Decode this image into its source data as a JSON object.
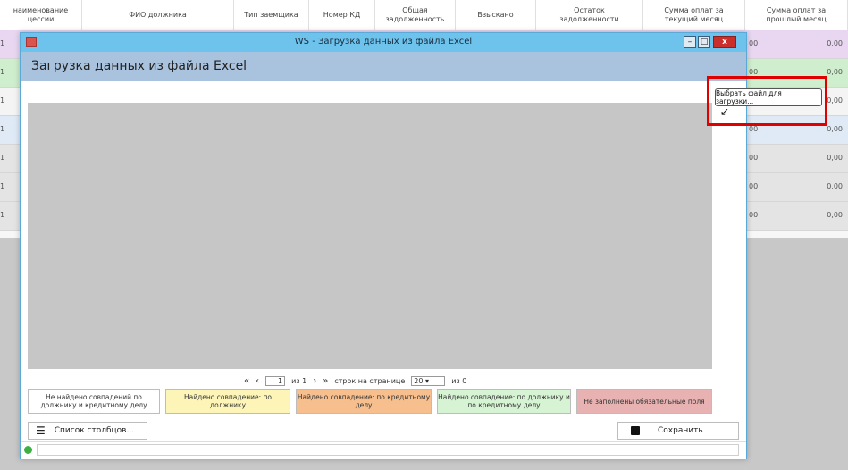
{
  "background": {
    "columns": [
      {
        "label": "наименование\nцессии"
      },
      {
        "label": "ФИО должника"
      },
      {
        "label": "Тип заемщика"
      },
      {
        "label": "Номер КД"
      },
      {
        "label": "Общая\nзадолженность"
      },
      {
        "label": "Взыскано"
      },
      {
        "label": "Остаток\nзадолженности"
      },
      {
        "label": "Сумма оплат за\nтекущий месяц"
      },
      {
        "label": "Сумма оплат за\nпрошлый месяц"
      }
    ],
    "rows": [
      {
        "left": "1",
        "mid": "00",
        "value": "0,00",
        "color": "#e9d7f2"
      },
      {
        "left": "1",
        "mid": "00",
        "value": "0,00",
        "color": "#cfeecd"
      },
      {
        "left": "1",
        "mid": "00",
        "value": "0,00",
        "color": "#f4f4f4"
      },
      {
        "left": "1",
        "mid": "00",
        "value": "0,00",
        "color": "#dfeaf6"
      },
      {
        "left": "1",
        "mid": "00",
        "value": "0,00",
        "color": "#e4e4e4"
      },
      {
        "left": "1",
        "mid": "00",
        "value": "0,00",
        "color": "#e4e4e4"
      },
      {
        "left": "1",
        "mid": "00",
        "value": "0,00",
        "color": "#e4e4e4"
      }
    ]
  },
  "dialog": {
    "window_title": "WS - Загрузка данных из файла Excel",
    "heading": "Загрузка данных из файла Excel",
    "min_label": "–",
    "max_label": "□",
    "close_label": "x",
    "pager": {
      "first": "«",
      "prev": "‹",
      "page": "1",
      "of": "из 1",
      "next": "›",
      "last": "»",
      "rows_label": "строк на странице",
      "rows_value": "20",
      "total": "из 0"
    },
    "legend": [
      {
        "text": "Не найдено совпадений по должнику и кредитному делу",
        "color": "#ffffff"
      },
      {
        "text": "Найдено совпадение: по должнику",
        "color": "#fdf5b8"
      },
      {
        "text": "Найдено совпадение: по кредитному делу",
        "color": "#f7bf8e"
      },
      {
        "text": "Найдено совпадение: по должнику и по кредитному делу",
        "color": "#d6f3d3"
      },
      {
        "text": "Не заполнены обязательные поля",
        "color": "#e8b2b2"
      }
    ],
    "columns_button": "Список столбцов...",
    "save_button": "Сохранить",
    "tooltip": "Выбрать файл для загрузки..."
  },
  "colors": {
    "titlebar": "#6dc3ec",
    "heading_bar": "#a9c3de",
    "grid_area": "#c6c6c6",
    "highlight": "#e00000"
  },
  "icons": {
    "list": "list-icon",
    "save": "floppy-disk-icon",
    "ok": "status-ok-icon"
  }
}
